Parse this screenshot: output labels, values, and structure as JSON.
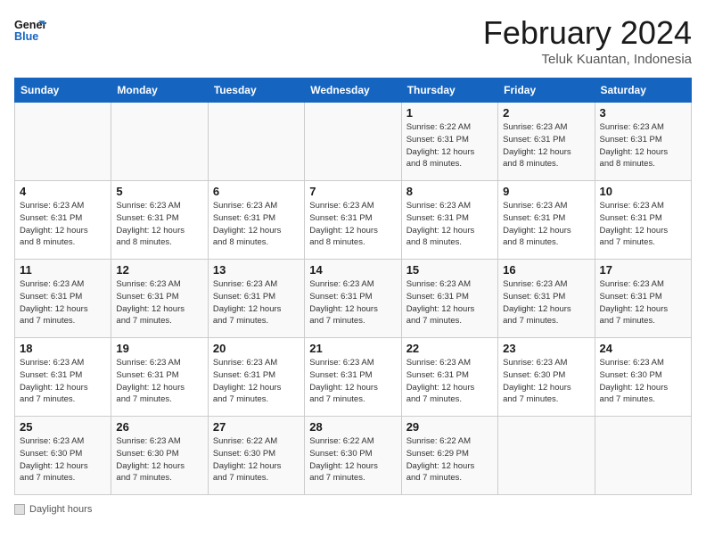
{
  "header": {
    "logo_line1": "General",
    "logo_line2": "Blue",
    "month": "February 2024",
    "location": "Teluk Kuantan, Indonesia"
  },
  "weekdays": [
    "Sunday",
    "Monday",
    "Tuesday",
    "Wednesday",
    "Thursday",
    "Friday",
    "Saturday"
  ],
  "weeks": [
    [
      {
        "day": "",
        "info": ""
      },
      {
        "day": "",
        "info": ""
      },
      {
        "day": "",
        "info": ""
      },
      {
        "day": "",
        "info": ""
      },
      {
        "day": "1",
        "info": "Sunrise: 6:22 AM\nSunset: 6:31 PM\nDaylight: 12 hours\nand 8 minutes."
      },
      {
        "day": "2",
        "info": "Sunrise: 6:23 AM\nSunset: 6:31 PM\nDaylight: 12 hours\nand 8 minutes."
      },
      {
        "day": "3",
        "info": "Sunrise: 6:23 AM\nSunset: 6:31 PM\nDaylight: 12 hours\nand 8 minutes."
      }
    ],
    [
      {
        "day": "4",
        "info": "Sunrise: 6:23 AM\nSunset: 6:31 PM\nDaylight: 12 hours\nand 8 minutes."
      },
      {
        "day": "5",
        "info": "Sunrise: 6:23 AM\nSunset: 6:31 PM\nDaylight: 12 hours\nand 8 minutes."
      },
      {
        "day": "6",
        "info": "Sunrise: 6:23 AM\nSunset: 6:31 PM\nDaylight: 12 hours\nand 8 minutes."
      },
      {
        "day": "7",
        "info": "Sunrise: 6:23 AM\nSunset: 6:31 PM\nDaylight: 12 hours\nand 8 minutes."
      },
      {
        "day": "8",
        "info": "Sunrise: 6:23 AM\nSunset: 6:31 PM\nDaylight: 12 hours\nand 8 minutes."
      },
      {
        "day": "9",
        "info": "Sunrise: 6:23 AM\nSunset: 6:31 PM\nDaylight: 12 hours\nand 8 minutes."
      },
      {
        "day": "10",
        "info": "Sunrise: 6:23 AM\nSunset: 6:31 PM\nDaylight: 12 hours\nand 7 minutes."
      }
    ],
    [
      {
        "day": "11",
        "info": "Sunrise: 6:23 AM\nSunset: 6:31 PM\nDaylight: 12 hours\nand 7 minutes."
      },
      {
        "day": "12",
        "info": "Sunrise: 6:23 AM\nSunset: 6:31 PM\nDaylight: 12 hours\nand 7 minutes."
      },
      {
        "day": "13",
        "info": "Sunrise: 6:23 AM\nSunset: 6:31 PM\nDaylight: 12 hours\nand 7 minutes."
      },
      {
        "day": "14",
        "info": "Sunrise: 6:23 AM\nSunset: 6:31 PM\nDaylight: 12 hours\nand 7 minutes."
      },
      {
        "day": "15",
        "info": "Sunrise: 6:23 AM\nSunset: 6:31 PM\nDaylight: 12 hours\nand 7 minutes."
      },
      {
        "day": "16",
        "info": "Sunrise: 6:23 AM\nSunset: 6:31 PM\nDaylight: 12 hours\nand 7 minutes."
      },
      {
        "day": "17",
        "info": "Sunrise: 6:23 AM\nSunset: 6:31 PM\nDaylight: 12 hours\nand 7 minutes."
      }
    ],
    [
      {
        "day": "18",
        "info": "Sunrise: 6:23 AM\nSunset: 6:31 PM\nDaylight: 12 hours\nand 7 minutes."
      },
      {
        "day": "19",
        "info": "Sunrise: 6:23 AM\nSunset: 6:31 PM\nDaylight: 12 hours\nand 7 minutes."
      },
      {
        "day": "20",
        "info": "Sunrise: 6:23 AM\nSunset: 6:31 PM\nDaylight: 12 hours\nand 7 minutes."
      },
      {
        "day": "21",
        "info": "Sunrise: 6:23 AM\nSunset: 6:31 PM\nDaylight: 12 hours\nand 7 minutes."
      },
      {
        "day": "22",
        "info": "Sunrise: 6:23 AM\nSunset: 6:31 PM\nDaylight: 12 hours\nand 7 minutes."
      },
      {
        "day": "23",
        "info": "Sunrise: 6:23 AM\nSunset: 6:30 PM\nDaylight: 12 hours\nand 7 minutes."
      },
      {
        "day": "24",
        "info": "Sunrise: 6:23 AM\nSunset: 6:30 PM\nDaylight: 12 hours\nand 7 minutes."
      }
    ],
    [
      {
        "day": "25",
        "info": "Sunrise: 6:23 AM\nSunset: 6:30 PM\nDaylight: 12 hours\nand 7 minutes."
      },
      {
        "day": "26",
        "info": "Sunrise: 6:23 AM\nSunset: 6:30 PM\nDaylight: 12 hours\nand 7 minutes."
      },
      {
        "day": "27",
        "info": "Sunrise: 6:22 AM\nSunset: 6:30 PM\nDaylight: 12 hours\nand 7 minutes."
      },
      {
        "day": "28",
        "info": "Sunrise: 6:22 AM\nSunset: 6:30 PM\nDaylight: 12 hours\nand 7 minutes."
      },
      {
        "day": "29",
        "info": "Sunrise: 6:22 AM\nSunset: 6:29 PM\nDaylight: 12 hours\nand 7 minutes."
      },
      {
        "day": "",
        "info": ""
      },
      {
        "day": "",
        "info": ""
      }
    ]
  ],
  "footer": {
    "daylight_label": "Daylight hours"
  }
}
